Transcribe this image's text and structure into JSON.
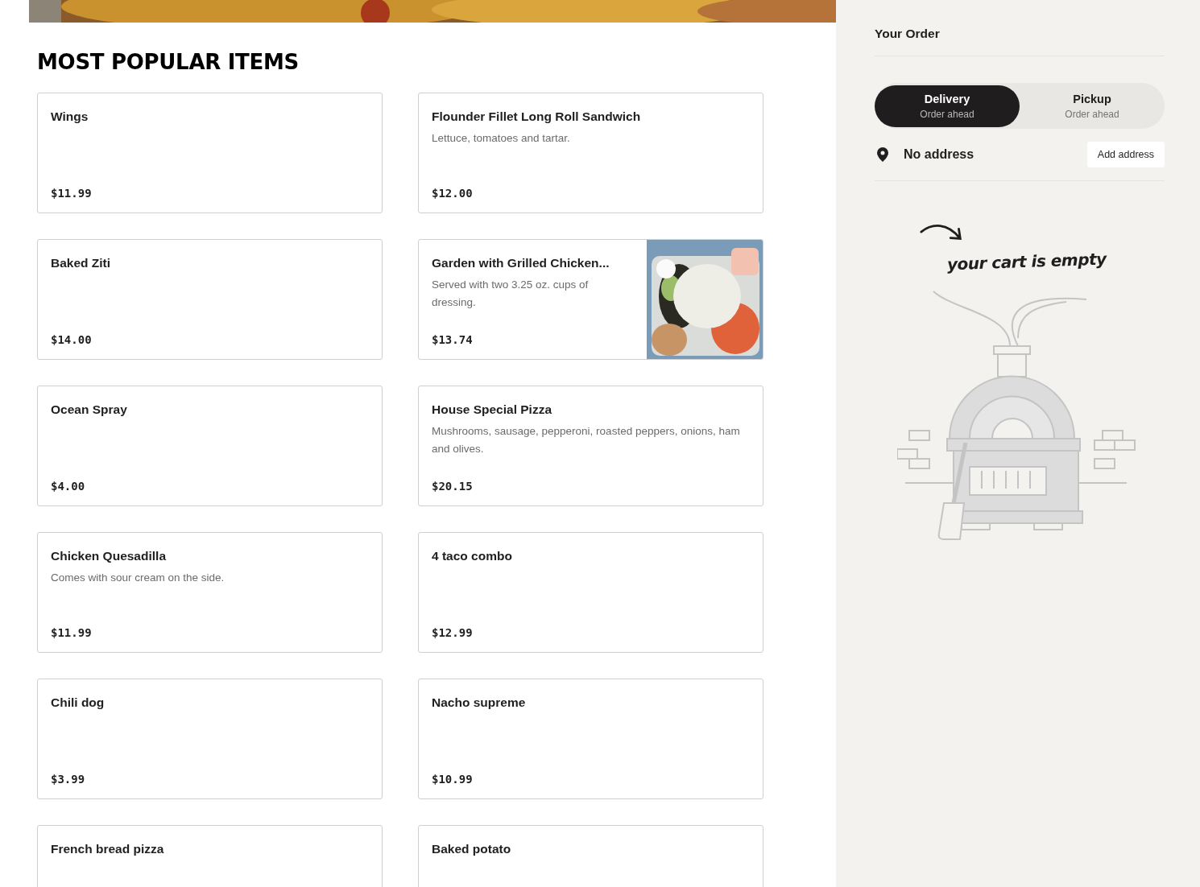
{
  "section": {
    "title": "MOST POPULAR ITEMS"
  },
  "items": [
    {
      "kind": "plain",
      "name": "Wings",
      "price": "$11.99"
    },
    {
      "kind": "plain",
      "name": "Flounder Fillet Long Roll Sandwich",
      "description": "Lettuce, tomatoes and tartar.",
      "price": "$12.00"
    },
    {
      "kind": "plain",
      "name": "Baked Ziti",
      "price": "$14.00"
    },
    {
      "name": "Garden with Grilled Chicken...",
      "description": "Served with two 3.25 oz. cups of dressing.",
      "price": "$13.74"
    },
    {
      "kind": "plain",
      "name": "Ocean Spray",
      "price": "$4.00"
    },
    {
      "kind": "plain",
      "name": "House Special Pizza",
      "description": "Mushrooms, sausage, pepperoni, roasted peppers, onions, ham and olives.",
      "price": "$20.15"
    },
    {
      "kind": "plain",
      "name": "Chicken Quesadilla",
      "description": "Comes with sour cream on the side.",
      "price": "$11.99"
    },
    {
      "kind": "plain",
      "name": "4 taco combo",
      "price": "$12.99"
    },
    {
      "kind": "plain",
      "name": "Chili dog",
      "price": "$3.99"
    },
    {
      "kind": "plain",
      "name": "Nacho supreme",
      "price": "$10.99"
    },
    {
      "kind": "plain",
      "name": "French bread pizza"
    },
    {
      "kind": "plain",
      "name": "Baked potato"
    }
  ],
  "order": {
    "title": "Your Order",
    "modes": [
      {
        "label": "Delivery",
        "sublabel": "Order ahead",
        "selected": true
      },
      {
        "label": "Pickup",
        "sublabel": "Order ahead",
        "selected": false
      }
    ],
    "address": "No address",
    "address_button": "Add address",
    "empty_message": "your cart is empty"
  }
}
